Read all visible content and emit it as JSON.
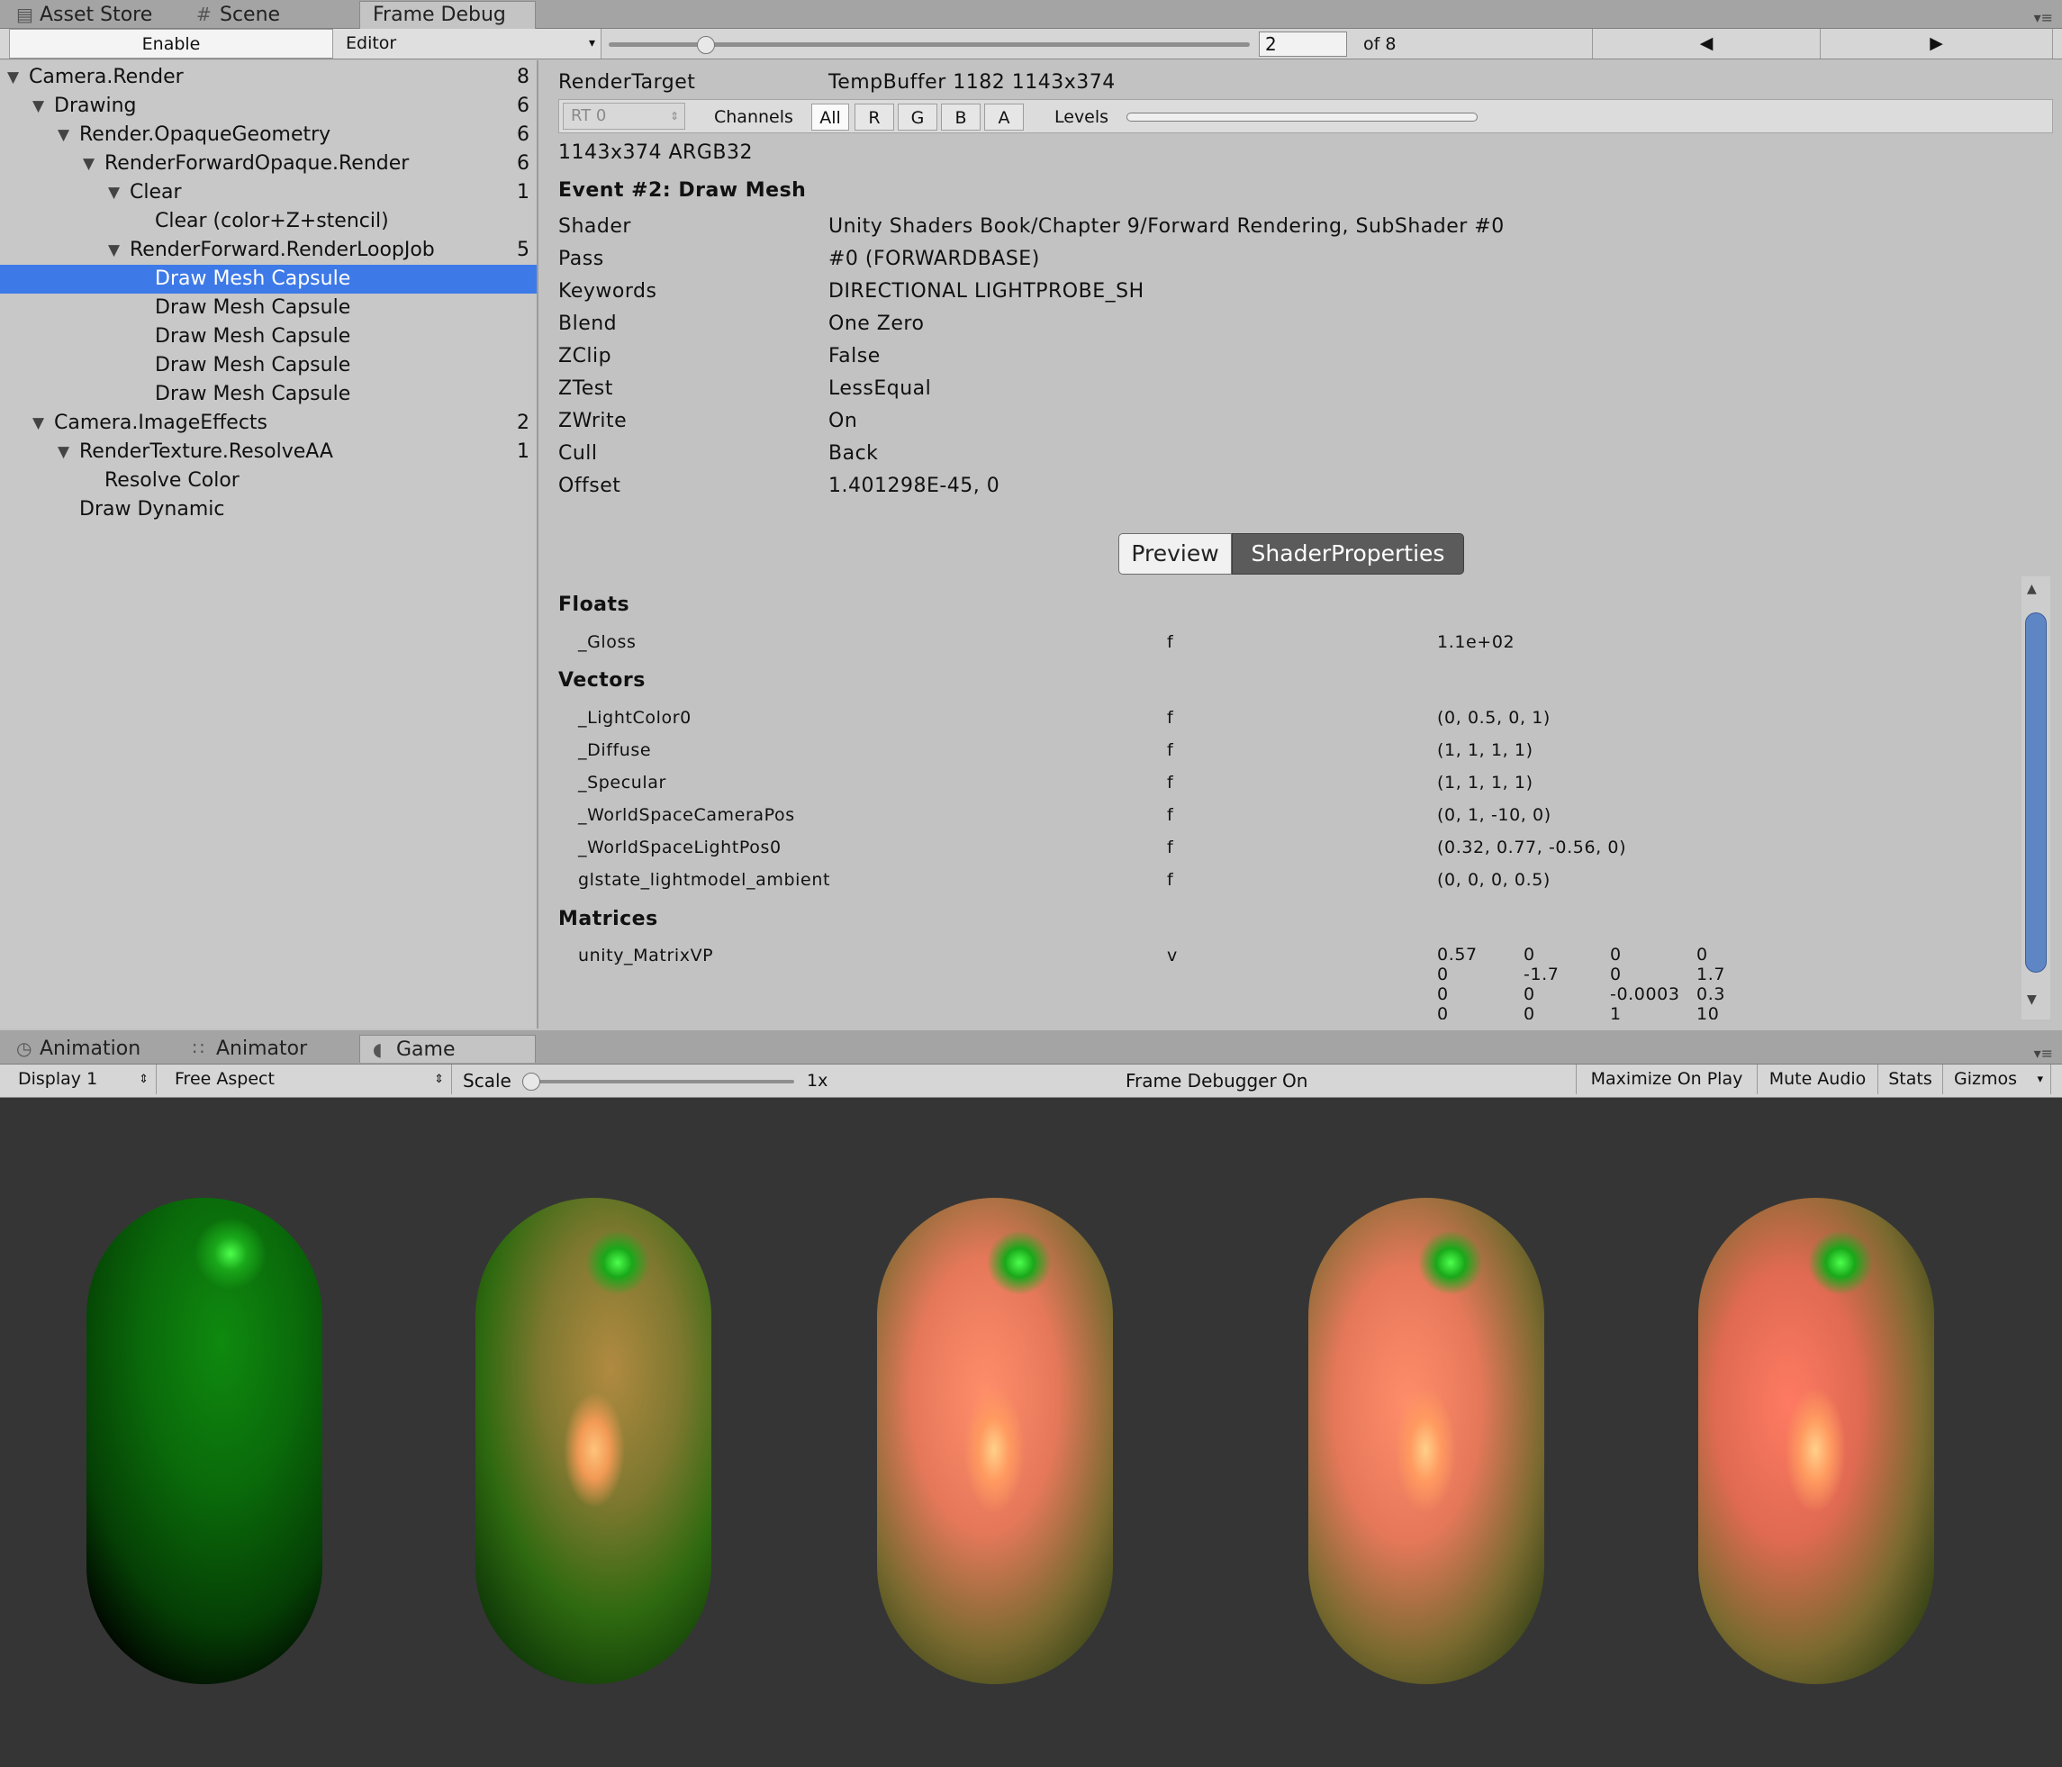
{
  "top_tabs": [
    {
      "label": "Asset Store",
      "icon": "asset-store-icon"
    },
    {
      "label": "Scene",
      "icon": "scene-grid-icon"
    },
    {
      "label": "Frame Debug",
      "icon": ""
    }
  ],
  "debug_toolbar": {
    "enable_label": "Enable",
    "target_label": "Editor",
    "event_value": "2",
    "of_label": "of 8",
    "prev_icon": "triangle-left-icon",
    "next_icon": "triangle-right-icon"
  },
  "tree": [
    {
      "label": "Camera.Render",
      "count": "8",
      "arrow": "▼"
    },
    {
      "label": "Drawing",
      "count": "6",
      "arrow": "▼"
    },
    {
      "label": "Render.OpaqueGeometry",
      "count": "6",
      "arrow": "▼"
    },
    {
      "label": "RenderForwardOpaque.Render",
      "count": "6",
      "arrow": "▼"
    },
    {
      "label": "Clear",
      "count": "1",
      "arrow": "▼"
    },
    {
      "label": "Clear (color+Z+stencil)",
      "count": "",
      "arrow": ""
    },
    {
      "label": "RenderForward.RenderLoopJob",
      "count": "5",
      "arrow": "▼"
    },
    {
      "label": "Draw Mesh Capsule",
      "count": "",
      "arrow": ""
    },
    {
      "label": "Draw Mesh Capsule",
      "count": "",
      "arrow": ""
    },
    {
      "label": "Draw Mesh Capsule",
      "count": "",
      "arrow": ""
    },
    {
      "label": "Draw Mesh Capsule",
      "count": "",
      "arrow": ""
    },
    {
      "label": "Draw Mesh Capsule",
      "count": "",
      "arrow": ""
    },
    {
      "label": "Camera.ImageEffects",
      "count": "2",
      "arrow": "▼"
    },
    {
      "label": "RenderTexture.ResolveAA",
      "count": "1",
      "arrow": "▼"
    },
    {
      "label": "Resolve Color",
      "count": "",
      "arrow": ""
    },
    {
      "label": "Draw Dynamic",
      "count": "",
      "arrow": ""
    }
  ],
  "detail": {
    "rt_label": "RenderTarget",
    "rt_value": "TempBuffer 1182 1143x374",
    "rt_select": "RT 0",
    "channels_label": "Channels",
    "channel_all": "All",
    "channel_r": "R",
    "channel_g": "G",
    "channel_b": "B",
    "channel_a": "A",
    "levels_label": "Levels",
    "format": "1143x374 ARGB32",
    "event_title": "Event #2: Draw Mesh",
    "rows": [
      {
        "key": "Shader",
        "value": "Unity Shaders Book/Chapter 9/Forward Rendering, SubShader #0"
      },
      {
        "key": "Pass",
        "value": "#0 (FORWARDBASE)"
      },
      {
        "key": "Keywords",
        "value": "DIRECTIONAL LIGHTPROBE_SH"
      },
      {
        "key": "Blend",
        "value": "One Zero"
      },
      {
        "key": "ZClip",
        "value": "False"
      },
      {
        "key": "ZTest",
        "value": "LessEqual"
      },
      {
        "key": "ZWrite",
        "value": "On"
      },
      {
        "key": "Cull",
        "value": "Back"
      },
      {
        "key": "Offset",
        "value": "1.401298E-45, 0"
      }
    ],
    "preview_label": "Preview",
    "shaderprops_label": "ShaderProperties"
  },
  "props": {
    "floats_heading": "Floats",
    "floats": [
      {
        "name": "_Gloss",
        "stage": "f",
        "value": "1.1e+02"
      }
    ],
    "vectors_heading": "Vectors",
    "vectors": [
      {
        "name": "_LightColor0",
        "stage": "f",
        "value": "(0, 0.5, 0, 1)"
      },
      {
        "name": "_Diffuse",
        "stage": "f",
        "value": "(1, 1, 1, 1)"
      },
      {
        "name": "_Specular",
        "stage": "f",
        "value": "(1, 1, 1, 1)"
      },
      {
        "name": "_WorldSpaceCameraPos",
        "stage": "f",
        "value": "(0, 1, -10, 0)"
      },
      {
        "name": "_WorldSpaceLightPos0",
        "stage": "f",
        "value": "(0.32, 0.77, -0.56, 0)"
      },
      {
        "name": "glstate_lightmodel_ambient",
        "stage": "f",
        "value": "(0, 0, 0, 0.5)"
      }
    ],
    "matrices_heading": "Matrices",
    "matrix_name": "unity_MatrixVP",
    "matrix_stage": "v",
    "matrix": [
      [
        "0.57",
        "0",
        "0",
        "0"
      ],
      [
        "0",
        "-1.7",
        "0",
        "1.7"
      ],
      [
        "0",
        "0",
        "-0.0003",
        "0.3"
      ],
      [
        "0",
        "0",
        "1",
        "10"
      ]
    ]
  },
  "bottom_tabs": [
    {
      "label": "Animation",
      "icon": "clock-icon"
    },
    {
      "label": "Animator",
      "icon": "animator-icon"
    },
    {
      "label": "Game",
      "icon": "game-pacman-icon"
    }
  ],
  "game_toolbar": {
    "display": "Display 1",
    "aspect": "Free Aspect",
    "scale_label": "Scale",
    "scale_value": "1x",
    "status": "Frame Debugger On",
    "maximize": "Maximize On Play",
    "mute": "Mute Audio",
    "stats": "Stats",
    "gizmos": "Gizmos"
  },
  "colors": {
    "selection": "#3d7ae8",
    "viewport_bg": "#353535",
    "panel_bg": "#c2c2c2",
    "capsule_green": "#0a7a0a",
    "capsule_highlight": "#ff9a60"
  }
}
